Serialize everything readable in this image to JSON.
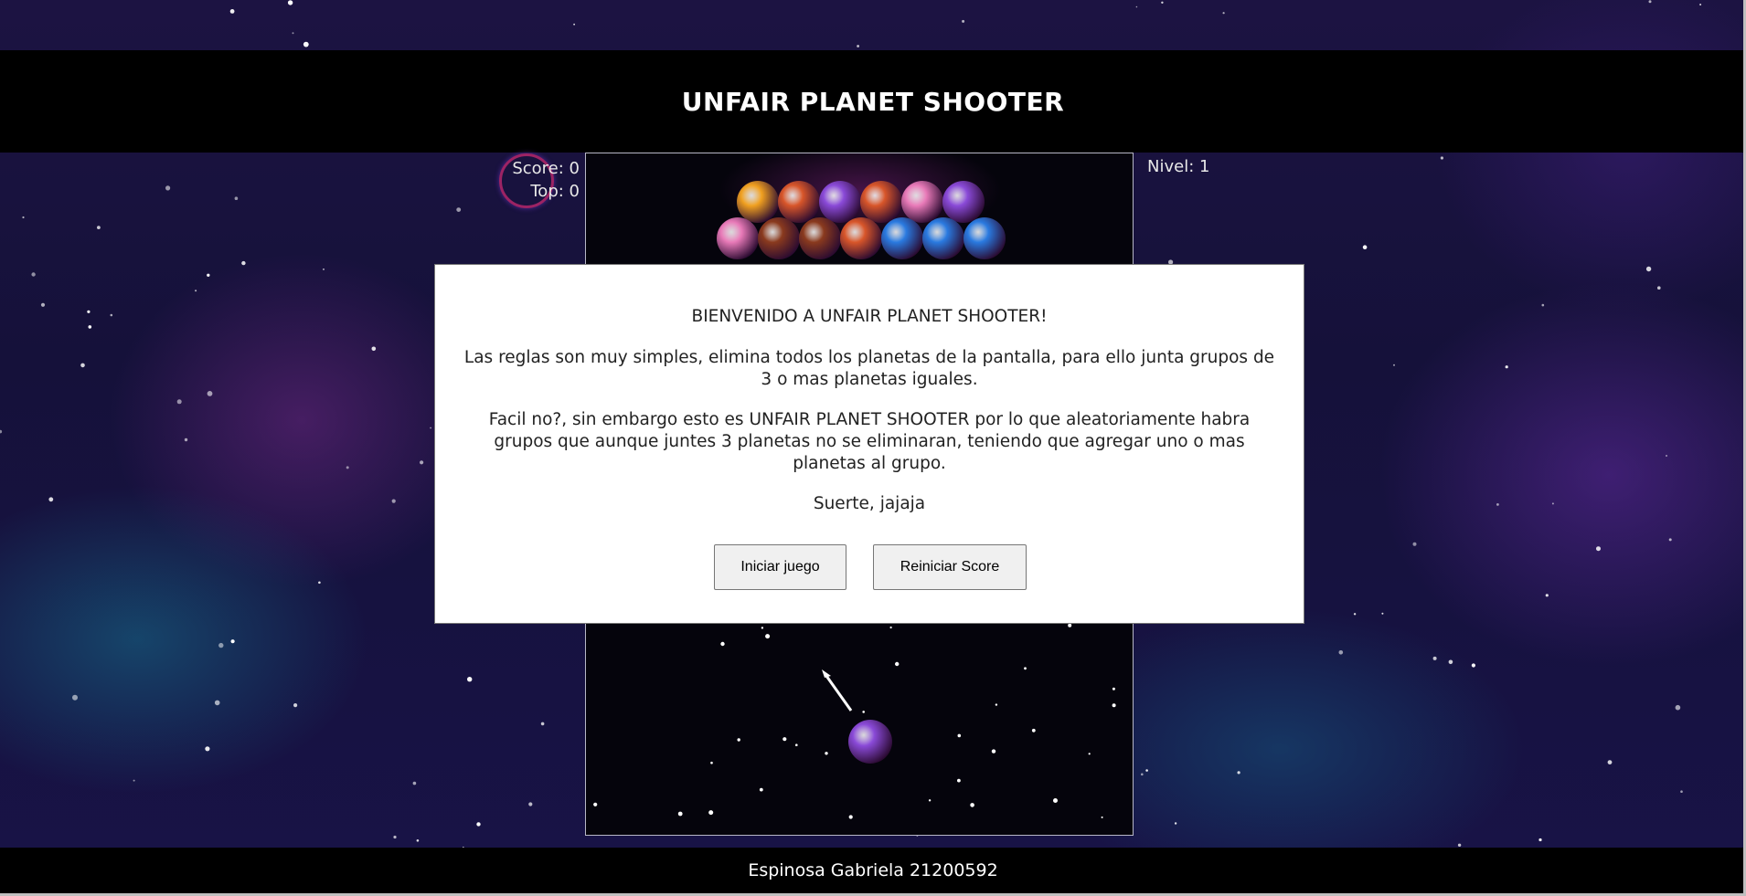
{
  "header": {
    "title": "UNFAIR PLANET SHOOTER"
  },
  "hud": {
    "score": "Score: 0",
    "top": "Top: 0",
    "level": "Nivel: 1"
  },
  "modal": {
    "title": "BIENVENIDO A UNFAIR PLANET SHOOTER!",
    "rules": "Las reglas son muy simples, elimina todos los planetas de la pantalla, para ello junta grupos de 3 o mas planetas iguales.",
    "warning": "Facil no?, sin embargo esto es UNFAIR PLANET SHOOTER por lo que aleatoriamente habra grupos que aunque juntes 3 planetas no se eliminaran, teniendo que agregar uno o mas planetas al grupo.",
    "luck": "Suerte, jajaja",
    "start_button": "Iniciar juego",
    "reset_button": "Reiniciar Score"
  },
  "footer": {
    "credit": "Espinosa Gabriela 21200592"
  },
  "planet_colors": {
    "orange": "#f0a020",
    "red-orange": "#d8562a",
    "purple": "#8a4ad8",
    "pink": "#e87ab8",
    "brown": "#8a3a1e",
    "blue": "#2a7ae0"
  },
  "planet_grid": {
    "rows": [
      [
        "orange",
        "red-orange",
        "purple",
        "red-orange",
        "pink",
        "purple"
      ],
      [
        "pink",
        "brown",
        "brown",
        "red-orange",
        "blue",
        "blue",
        "blue"
      ]
    ],
    "shooter": "purple"
  }
}
